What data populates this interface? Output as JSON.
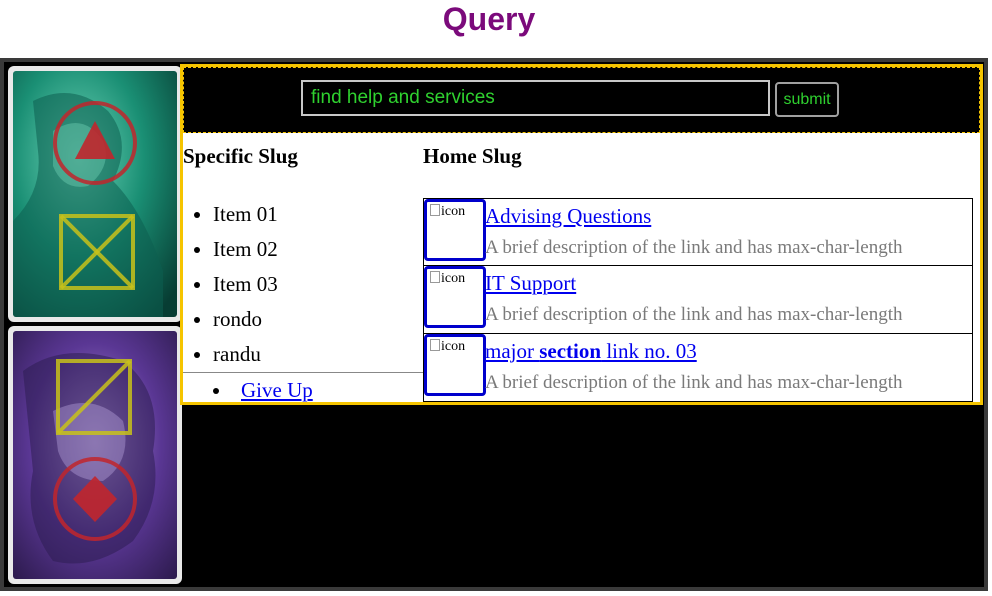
{
  "page": {
    "title": "Query"
  },
  "search": {
    "placeholder": "find help and services",
    "submit_label": "submit"
  },
  "specific_slug": {
    "heading": "Specific Slug",
    "items": [
      "Item 01",
      "Item 02",
      "Item 03",
      "rondo",
      "randu"
    ],
    "give_up_label": "Give Up"
  },
  "home_slug": {
    "heading": "Home Slug",
    "links": [
      {
        "icon_alt": "icon",
        "title_pre": "Advising Questions",
        "title_bold": "",
        "title_post": "",
        "description": "A brief description of the link and has max-char-length"
      },
      {
        "icon_alt": "icon",
        "title_pre": "IT Support",
        "title_bold": "",
        "title_post": "",
        "description": "A brief description of the link and has max-char-length"
      },
      {
        "icon_alt": "icon",
        "title_pre": "major ",
        "title_bold": "section",
        "title_post": " link no. 03",
        "description": "A brief description of the link and has max-char-length"
      }
    ]
  },
  "cards": [
    {
      "name": "teal-statue-card",
      "tint": "#0f8f78",
      "symbols": [
        "circle-triangle",
        "square-x"
      ]
    },
    {
      "name": "purple-statue-card",
      "tint": "#6a3fa8",
      "symbols": [
        "square-slash",
        "circle-diamond"
      ]
    }
  ],
  "colors": {
    "title": "#7b0a7b",
    "accent_border": "#f5c400",
    "search_text": "#2fd12f",
    "link": "#0000ee",
    "icon_border": "#0000cc",
    "description": "#7a7a7a"
  }
}
